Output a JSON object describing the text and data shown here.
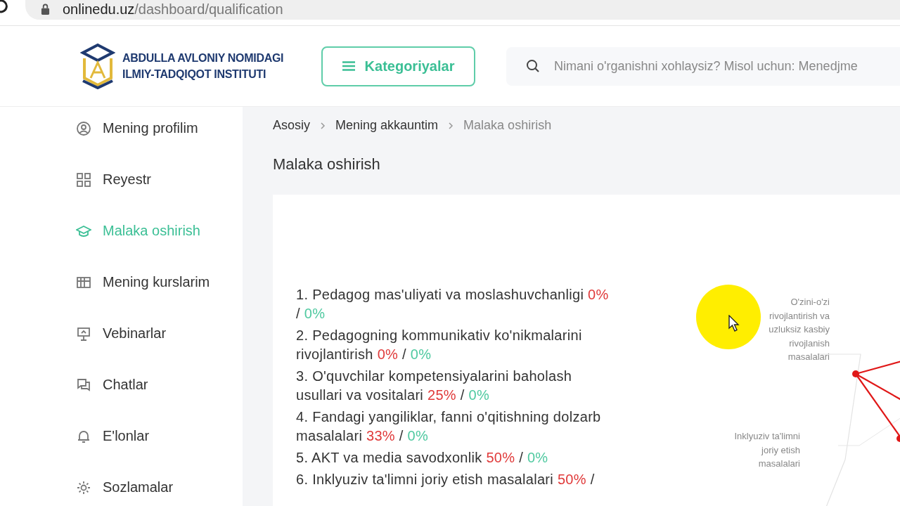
{
  "browser": {
    "url_host": "onlinedu.uz",
    "url_path": "/dashboard/qualification"
  },
  "header": {
    "logo_lines": [
      "ABDULLA AVLONIY NOMIDAGI",
      "ILMIY-TADQIQOT INSTITUTI"
    ],
    "categories_button": "Kategoriyalar",
    "search": {
      "placeholder": "Nimani o'rganishni xohlaysiz? Misol uchun: Menedjme"
    }
  },
  "sidebar": {
    "items": [
      {
        "label": "Mening profilim",
        "selected": false
      },
      {
        "label": "Reyestr",
        "selected": false
      },
      {
        "label": "Malaka oshirish",
        "selected": true
      },
      {
        "label": "Mening kurslarim",
        "selected": false
      },
      {
        "label": "Vebinarlar",
        "selected": false
      },
      {
        "label": "Chatlar",
        "selected": false
      },
      {
        "label": "E'lonlar",
        "selected": false
      },
      {
        "label": "Sozlamalar",
        "selected": false
      }
    ]
  },
  "breadcrumbs": [
    {
      "label": "Asosiy",
      "current": false
    },
    {
      "label": "Mening akkauntim",
      "current": false
    },
    {
      "label": "Malaka oshirish",
      "current": true
    }
  ],
  "page_title": "Malaka oshirish",
  "competencies": [
    {
      "text": "1. Pedagog mas'uliyati va moslashuvchanligi",
      "score": "0%",
      "separator": "/",
      "target": "0%"
    },
    {
      "text": "2. Pedagogning kommunikativ ko'nikmalarini rivojlantirish",
      "score": "0%",
      "separator": "/",
      "target": "0%"
    },
    {
      "text": "3. O'quvchilar kompetensiyalarini baholash usullari va vositalari",
      "score": "25%",
      "separator": "/",
      "target": "0%"
    },
    {
      "text": "4. Fandagi yangiliklar, fanni o'qitishning dolzarb masalalari",
      "score": "33%",
      "separator": "/",
      "target": "0%"
    },
    {
      "text": "5. AKT va media savodxonlik",
      "score": "50%",
      "separator": "/",
      "target": "0%"
    },
    {
      "text": "6. Inklyuziv ta'limni joriy etish masalalari",
      "score": "50%",
      "separator": "/"
    }
  ],
  "radar_labels": [
    "O'zini-o'zi rivojlantirish va uzluksiz kasbiy rivojlanish masalalari",
    "Inklyuziv ta'limni joriy etish masalalari"
  ]
}
